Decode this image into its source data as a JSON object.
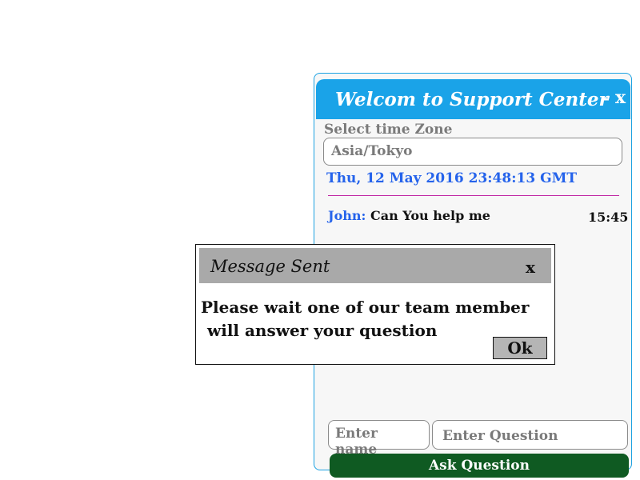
{
  "support_window": {
    "title": "Welcom to Support Center",
    "minimize_label": "-",
    "close_label": "x",
    "timezone_label": "Select time Zone",
    "timezone_value": "Asia/Tokyo",
    "datetime": "Thu, 12 May 2016 23:48:13 GMT",
    "messages": [
      {
        "sender": "John:",
        "text": "Can You help me",
        "time": "15:45"
      }
    ],
    "name_placeholder": "Enter name",
    "question_placeholder": "Enter Question",
    "ask_button_label": "Ask Question"
  },
  "dialog": {
    "title": "Message Sent",
    "close_label": "x",
    "message_line1": "Please wait one of our team member",
    "message_line2": "will answer your question",
    "ok_label": "Ok"
  },
  "colors": {
    "header_blue": "#1aa3e8",
    "ask_button_green": "#0f5a22",
    "datetime_blue": "#2563eb",
    "divider_magenta": "#c026a3",
    "dialog_titlebar_gray": "#a9a9a9"
  }
}
